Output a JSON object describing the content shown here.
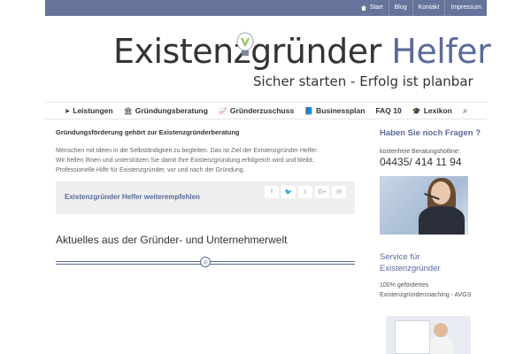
{
  "topnav": {
    "items": [
      {
        "label": "Start",
        "icon": "home-icon"
      },
      {
        "label": "Blog"
      },
      {
        "label": "Kontakt"
      },
      {
        "label": "Impressum"
      }
    ]
  },
  "logo": {
    "part1": "Existenzgründer",
    "part2": "Helfer",
    "tagline": "Sicher starten - Erfolg ist planbar",
    "icon": "lightbulb-icon",
    "colors": {
      "dark": "#333333",
      "blue": "#5a6a9a",
      "bulb": "#8bc34a"
    }
  },
  "mainnav": {
    "items": [
      {
        "label": "Leistungen",
        "icon": "paper-plane-icon",
        "glyph": "➤"
      },
      {
        "label": "Gründungsberatung",
        "icon": "bank-icon",
        "glyph": "🏛"
      },
      {
        "label": "Gründerzuschuss",
        "icon": "chart-icon",
        "glyph": "📈"
      },
      {
        "label": "Businessplan",
        "icon": "book-icon",
        "glyph": "📘"
      },
      {
        "label": "FAQ 10"
      },
      {
        "label": "Lexikon",
        "icon": "graduation-cap-icon",
        "glyph": "🎓"
      }
    ],
    "search_icon": "search-icon",
    "search_glyph": "⌕"
  },
  "main": {
    "heading": "Gründungsförderung gehört zur Existenzgründerberatung",
    "intro_lines": [
      "Menschen mit Ideen in die Selbständigkeit zu begleiten. Das ist Ziel der Existenzgründer Helfer.",
      "Wir helfen Ihnen und unterstützen Sie damit Ihre Existenzgründung erfolgreich wird und bleibt.",
      "Professionelle Hilfe für Existenzgründer, vor und nach der Gründung."
    ],
    "share": {
      "label": "Existenzgründer Helfer weiterempfehlen",
      "buttons": [
        {
          "icon": "facebook-icon",
          "glyph": "f"
        },
        {
          "icon": "twitter-icon",
          "glyph": "🐦"
        },
        {
          "icon": "tumblr-icon",
          "glyph": "t"
        },
        {
          "icon": "google-plus-icon",
          "glyph": "G+"
        },
        {
          "icon": "email-icon",
          "glyph": "✉"
        }
      ]
    },
    "news_title": "Aktuelles aus der Gründer- und Unternehmerwelt",
    "divider_icon": "feed-icon",
    "divider_glyph": "◎"
  },
  "sidebar": {
    "question_title": "Haben Sie noch Fragen ?",
    "hotline_label": "kostenfreie Beratungshotline:",
    "phone": "04435/ 414 11 94",
    "service_title": "Service für Existenzgründer",
    "service_text": "100% gefördertes Existenzgründercoaching - AVGS"
  }
}
